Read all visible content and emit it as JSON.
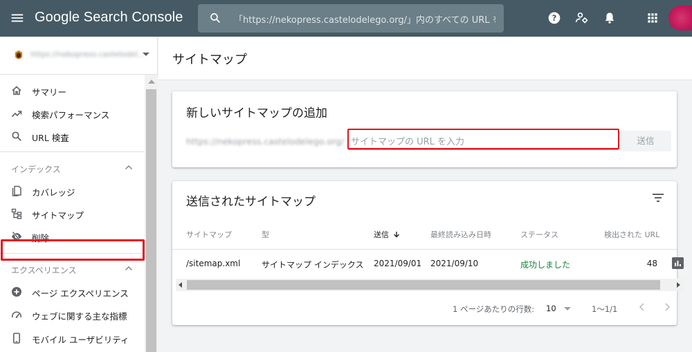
{
  "topbar": {
    "logo": "Google Search Console",
    "search_placeholder": "「https://nekopress.castelodelego.org/」内のすべての URL を検",
    "icons": [
      "menu-icon",
      "search-icon",
      "help-icon",
      "user-settings-icon",
      "bell-icon",
      "apps-icon"
    ]
  },
  "sidebar": {
    "property_url": "https://nekopress.castelodel...",
    "nav": [
      {
        "label": "サマリー",
        "icon": "home-icon"
      },
      {
        "label": "検索パフォーマンス",
        "icon": "trending-icon"
      },
      {
        "label": "URL 検査",
        "icon": "search-icon"
      }
    ],
    "index_section": "インデックス",
    "index_items": [
      {
        "label": "カバレッジ",
        "icon": "copy-icon"
      },
      {
        "label": "サイトマップ",
        "icon": "sitemap-icon"
      },
      {
        "label": "削除",
        "icon": "eye-off-icon"
      }
    ],
    "experience_section": "エクスペリエンス",
    "experience_items": [
      {
        "label": "ページ エクスペリエンス",
        "icon": "plus-circle-icon"
      },
      {
        "label": "ウェブに関する主な指標",
        "icon": "gauge-icon"
      },
      {
        "label": "モバイル ユーザビリティ",
        "icon": "phone-icon"
      }
    ]
  },
  "main": {
    "page_title": "サイトマップ",
    "add_card": {
      "title": "新しいサイトマップの追加",
      "prefix": "https://nekopress.castelodelego.org/",
      "input_placeholder": "サイトマップの URL を入力",
      "submit_label": "送信"
    },
    "submitted_card": {
      "title": "送信されたサイトマップ",
      "columns": [
        "サイトマップ",
        "型",
        "送信",
        "最終読み込み日時",
        "ステータス",
        "検出された URL"
      ],
      "rows": [
        {
          "sitemap": "/sitemap.xml",
          "type": "サイトマップ インデックス",
          "submitted": "2021/09/01",
          "last_read": "2021/09/10",
          "status": "成功しました",
          "urls": "48"
        }
      ],
      "rows_per_page_label": "1 ページあたりの行数:",
      "rows_per_page": "10",
      "range": "1〜1/1"
    }
  },
  "colors": {
    "topbar": "#455a64",
    "highlight": "#e8121c",
    "success": "#188038"
  }
}
